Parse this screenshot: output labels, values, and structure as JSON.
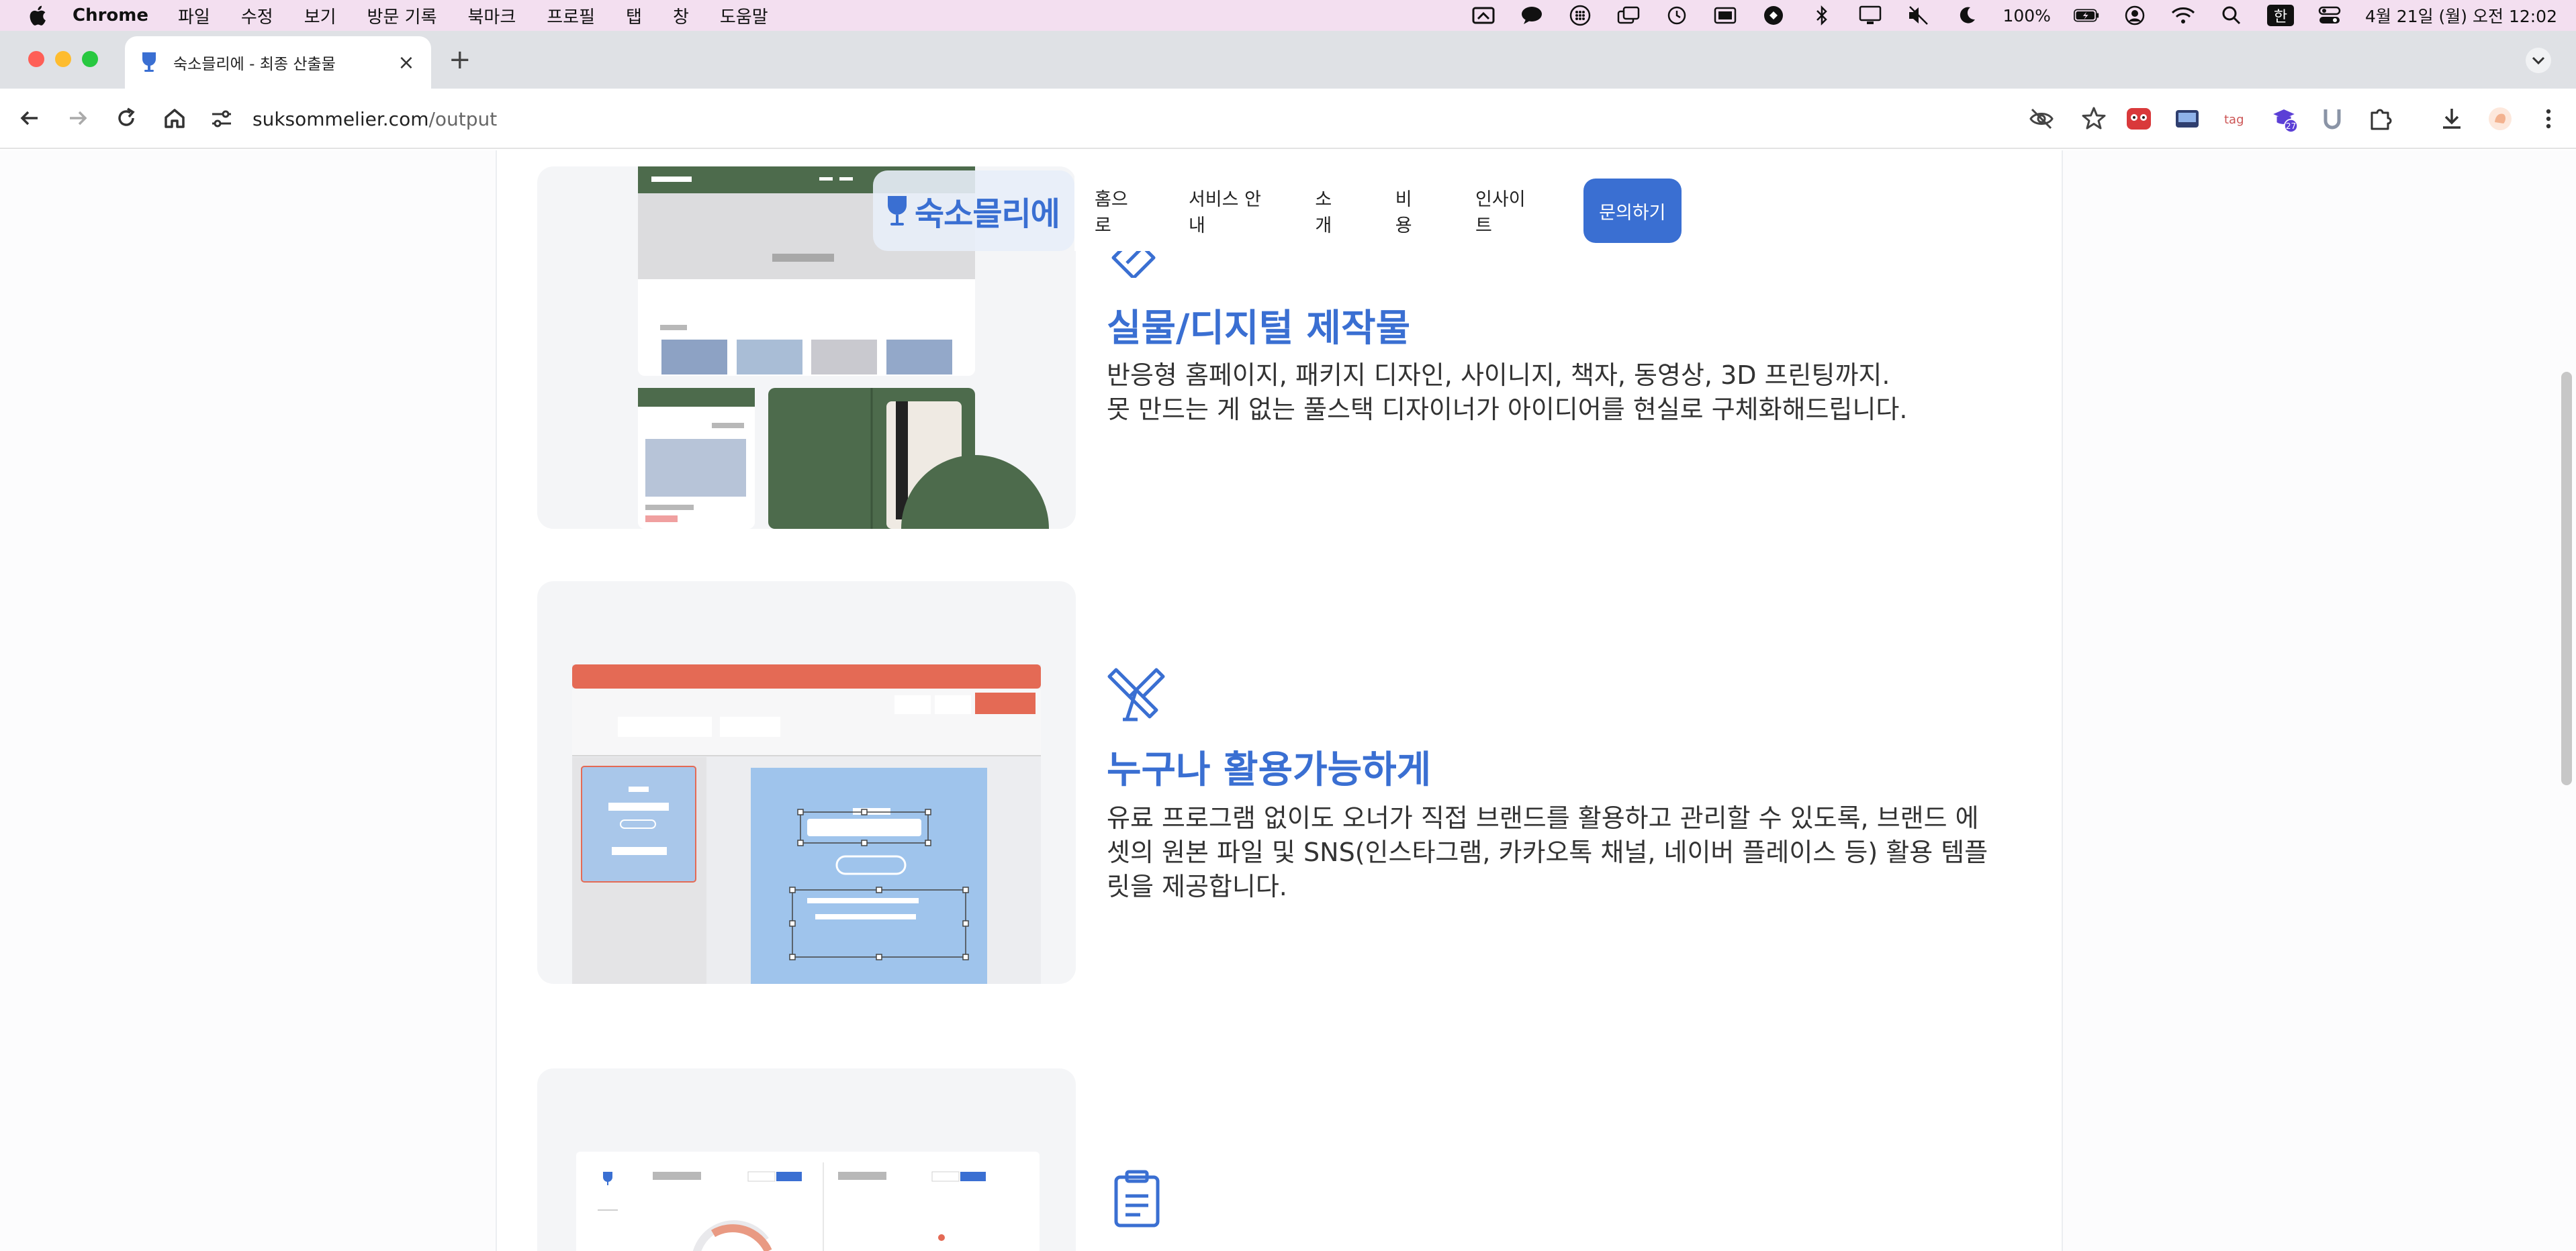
{
  "menubar": {
    "app_name": "Chrome",
    "items": [
      "파일",
      "수정",
      "보기",
      "방문 기록",
      "북마크",
      "프로필",
      "탭",
      "창",
      "도움말"
    ],
    "battery": "100%",
    "ime": "한",
    "clock": "4월 21일 (월) 오전 12:02"
  },
  "tab": {
    "title": "숙소믈리에 - 최종 산출물"
  },
  "toolbar": {
    "url_host": "suksommelier.com",
    "url_path": "/output",
    "extension_badge": "27"
  },
  "site_nav": {
    "logo": "숙소믈리에",
    "links": [
      "홈으로",
      "서비스 안내",
      "소개",
      "비용",
      "인사이트"
    ],
    "contact": "문의하기"
  },
  "features": [
    {
      "title": "실물/디지털 제작물",
      "desc": "반응형 홈페이지, 패키지 디자인, 사이니지, 책자, 동영상, 3D 프린팅까지.\n못 만드는 게 없는 풀스택 디자이너가 아이디어를 현실로 구체화해드립니다."
    },
    {
      "title": "누구나 활용가능하게",
      "desc": "유료 프로그램 없이도 오너가 직접 브랜드를 활용하고 관리할 수 있도록, 브랜드 에셋의 원본 파일 및 SNS(인스타그램, 카카오톡 채널, 네이버 플레이스 등) 활용 템플릿을 제공합니다."
    }
  ],
  "colors": {
    "accent": "#3a6fd2",
    "menubar_bg": "#f3dff0",
    "green": "#4d6b4c",
    "coral": "#e46a55"
  }
}
